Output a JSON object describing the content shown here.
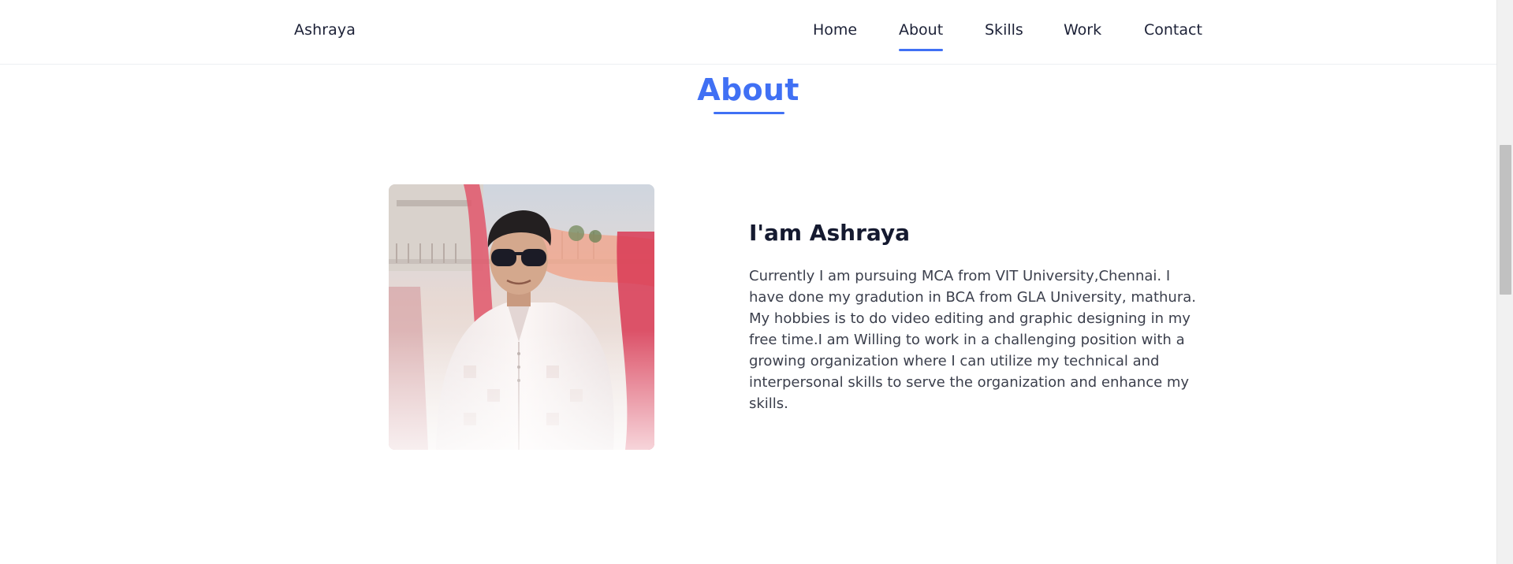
{
  "header": {
    "logo": "Ashraya",
    "nav": [
      {
        "label": "Home"
      },
      {
        "label": "About"
      },
      {
        "label": "Skills"
      },
      {
        "label": "Work"
      },
      {
        "label": "Contact"
      }
    ],
    "active_nav": "About"
  },
  "about": {
    "section_title": "About",
    "heading": "I'am Ashraya",
    "description": "Currently I am pursuing MCA from VIT University,Chennai. I have done my gradution in BCA from GLA University, mathura. My hobbies is to do video editing and graphic designing in my free time.I am Willing to work in a challenging position with a growing organization where I can utilize my technical and interpersonal skills to serve the organization and enhance my skills."
  },
  "colors": {
    "accent": "#4070f4",
    "text_dark": "#151a30",
    "text_body": "#3b3f4c"
  }
}
